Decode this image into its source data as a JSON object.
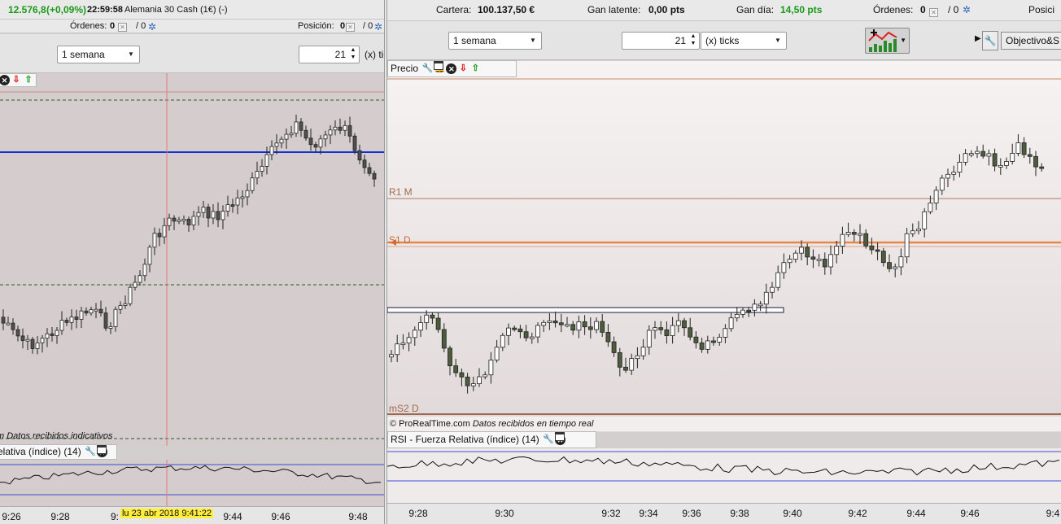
{
  "left": {
    "ticker": {
      "price": "12.576,8",
      "change": "(+0,09%)",
      "time": "22:59:58",
      "name": "Alemania 30 Cash (1€) (-)"
    },
    "orders_label": "Órdenes:",
    "orders_value": "0",
    "orders_sep": "/ 0",
    "position_label": "Posición:",
    "position_value": "0",
    "position_sep": "/ 0",
    "period": "1 semana",
    "ticks_value": "21",
    "ticks_label": "(x) tic",
    "footer_text_prefix": "m",
    "footer_text": "Datos recibidos indicativos",
    "rsi_label": "elativa (índice) (14)",
    "cursor_date": "lu 23 abr 2018 9:41:22",
    "x_ticks": [
      "9:26",
      "9:28",
      "9:",
      "9:44",
      "9:46",
      "9:48"
    ]
  },
  "right": {
    "cartera_label": "Cartera:",
    "cartera_value": "100.137,50 €",
    "latente_label": "Gan latente:",
    "latente_value": "0,00 pts",
    "dia_label": "Gan día:",
    "dia_value": "14,50 pts",
    "orders_label": "Órdenes:",
    "orders_value": "0",
    "orders_sep": "/ 0",
    "position_label": "Posici",
    "period": "1 semana",
    "ticks_value": "21",
    "ticks_label": "(x) ticks",
    "objective_label": "Objectivo&S",
    "price_label": "Precio",
    "r1_label": "R1 M",
    "s1_label": "S1 D",
    "ms2_label": "mS2 D",
    "copyright": "© ProRealTime.com",
    "data_note": "Datos recibidos en tiempo real",
    "rsi_label": "RSI - Fuerza Relativa (índice) (14)",
    "x_ticks": [
      "9:28",
      "9:30",
      "9:32",
      "9:34",
      "9:36",
      "9:38",
      "9:40",
      "9:42",
      "9:44",
      "9:46",
      "9:4"
    ]
  },
  "colors": {
    "candle_up": "#ffffff",
    "candle_down_left": "#505050",
    "candle_down_right": "#4d5c3c",
    "blue_line": "#1030d0",
    "pivot_orange": "#e8874a",
    "pivot_brown": "#b07a5a",
    "green_text": "#1a9a1a"
  },
  "icons": [
    "wrench-icon",
    "window-icon",
    "bell-icon",
    "close-icon",
    "arrow-down-icon",
    "arrow-up-icon",
    "gear-icon",
    "indicator-add-icon"
  ]
}
